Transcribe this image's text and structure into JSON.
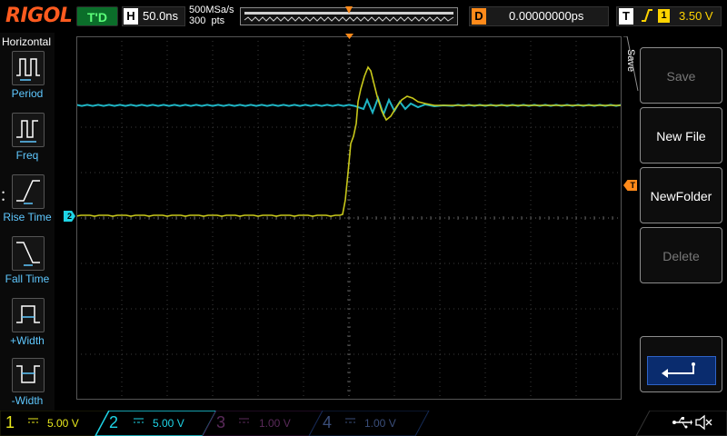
{
  "topbar": {
    "brand": "RIGOL",
    "run_state": "T'D",
    "timebase_letter": "H",
    "timebase": "50.0ns",
    "sample_rate": "500MSa/s",
    "memory_depth": "300  pts",
    "delay_letter": "D",
    "delay": "0.00000000ps",
    "trigger_letter": "T",
    "trigger_edge": "↗",
    "trigger_source": "1",
    "trigger_level": "3.50 V"
  },
  "left_panel": {
    "title": "Horizontal",
    "items": [
      {
        "label": "Period",
        "icon": "period-icon"
      },
      {
        "label": "Freq",
        "icon": "frequency-icon"
      },
      {
        "label": "Rise Time",
        "icon": "rise-time-icon"
      },
      {
        "label": "Fall Time",
        "icon": "fall-time-icon"
      },
      {
        "label": "+Width",
        "icon": "positive-width-icon"
      },
      {
        "label": "-Width",
        "icon": "negative-width-icon"
      }
    ]
  },
  "markers": {
    "ch2": "2",
    "trigger_level": "T"
  },
  "menu": {
    "title": "Save",
    "keys": [
      {
        "label": "Save",
        "enabled": false
      },
      {
        "label": "New File",
        "enabled": true
      },
      {
        "label": "NewFolder",
        "enabled": true
      },
      {
        "label": "Delete",
        "enabled": false
      }
    ],
    "return_icon": "return-arrow-icon"
  },
  "channels": [
    {
      "num": "1",
      "coupling": "DC",
      "scale": "5.00 V",
      "color": "#e8e81c",
      "active": true
    },
    {
      "num": "2",
      "coupling": "DC",
      "scale": "5.00 V",
      "color": "#1ed4e6",
      "active": true
    },
    {
      "num": "3",
      "coupling": "DC",
      "scale": "1.00 V",
      "color": "#c61fc6",
      "active": false
    },
    {
      "num": "4",
      "coupling": "DC",
      "scale": "1.00 V",
      "color": "#2e6ee8",
      "active": false
    }
  ],
  "status_icons": [
    "usb-icon",
    "speaker-mute-icon"
  ],
  "colors": {
    "ch1": "#c8c81a",
    "ch2": "#1fb5c4",
    "trigger": "#ff8a1a",
    "brand": "#ff5b1f"
  }
}
